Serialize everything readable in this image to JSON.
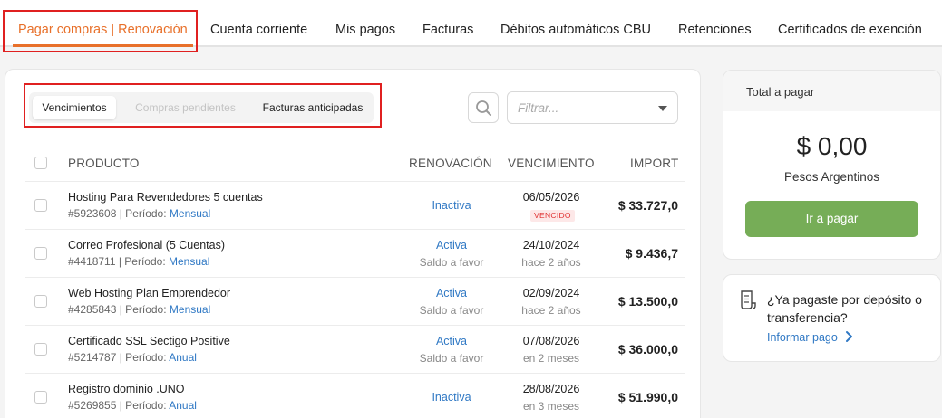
{
  "nav": {
    "tabs": [
      {
        "label": "Pagar compras | Renovación",
        "active": true
      },
      {
        "label": "Cuenta corriente"
      },
      {
        "label": "Mis pagos"
      },
      {
        "label": "Facturas"
      },
      {
        "label": "Débitos automáticos CBU"
      },
      {
        "label": "Retenciones"
      },
      {
        "label": "Certificados de exención"
      }
    ]
  },
  "subtabs": {
    "items": [
      "Vencimientos",
      "Compras pendientes",
      "Facturas anticipadas"
    ],
    "active": "Vencimientos",
    "disabled": "Compras pendientes"
  },
  "filter": {
    "placeholder": "Filtrar..."
  },
  "table": {
    "headers": {
      "product": "PRODUCTO",
      "renewal": "RENOVACIÓN",
      "due": "VENCIMIENTO",
      "amount": "IMPORT"
    },
    "rows": [
      {
        "product": "Hosting Para Revendedores 5 cuentas",
        "id": "#5923608",
        "period_label": "| Período:",
        "period": "Mensual",
        "renewal": "Inactiva",
        "renewal_sub": "",
        "due": "06/05/2026",
        "due_sub": "",
        "badge": "VENCIDO",
        "amount": "$ 33.727,0"
      },
      {
        "product": "Correo Profesional (5 Cuentas)",
        "id": "#4418711",
        "period_label": "| Período:",
        "period": "Mensual",
        "renewal": "Activa",
        "renewal_sub": "Saldo a favor",
        "due": "24/10/2024",
        "due_sub": "hace 2 años",
        "badge": "",
        "amount": "$ 9.436,7"
      },
      {
        "product": "Web Hosting Plan Emprendedor",
        "id": "#4285843",
        "period_label": "| Período:",
        "period": "Mensual",
        "renewal": "Activa",
        "renewal_sub": "Saldo a favor",
        "due": "02/09/2024",
        "due_sub": "hace 2 años",
        "badge": "",
        "amount": "$ 13.500,0"
      },
      {
        "product": "Certificado SSL Sectigo Positive",
        "id": "#5214787",
        "period_label": "| Período:",
        "period": "Anual",
        "renewal": "Activa",
        "renewal_sub": "Saldo a favor",
        "due": "07/08/2026",
        "due_sub": "en 2 meses",
        "badge": "",
        "amount": "$ 36.000,0"
      },
      {
        "product": "Registro dominio .UNO",
        "id": "#5269855",
        "period_label": "| Período:",
        "period": "Anual",
        "renewal": "Inactiva",
        "renewal_sub": "",
        "due": "28/08/2026",
        "due_sub": "en 3 meses",
        "badge": "",
        "amount": "$ 51.990,0"
      }
    ]
  },
  "total": {
    "title": "Total a pagar",
    "amount": "$ 0,00",
    "currency": "Pesos Argentinos",
    "pay_button": "Ir a pagar"
  },
  "deposit": {
    "question": "¿Ya pagaste por depósito o transferencia?",
    "link": "Informar pago"
  },
  "colors": {
    "accent": "#e8702a",
    "link": "#2f78c4",
    "pay": "#76ad57",
    "highlight": "#e02020"
  }
}
